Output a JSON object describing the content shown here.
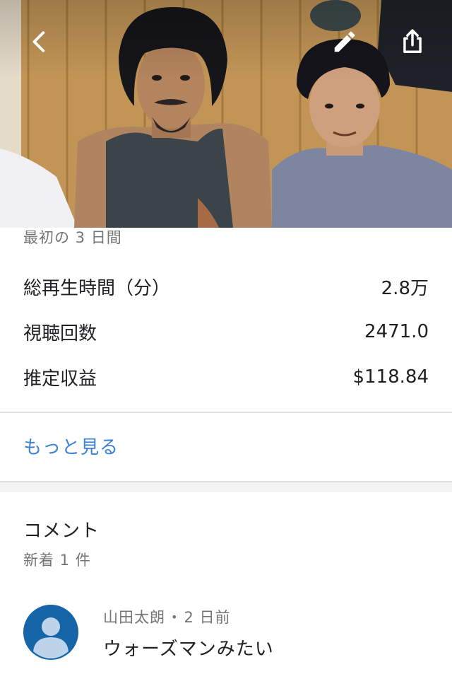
{
  "header": {
    "back_icon": "chevron-left-icon",
    "edit_icon": "pencil-icon",
    "share_icon": "share-icon"
  },
  "stats": {
    "period_label": "最初の 3 日間",
    "rows": [
      {
        "label": "総再生時間（分）",
        "value": "2.8万"
      },
      {
        "label": "視聴回数",
        "value": "2471.0"
      },
      {
        "label": "推定収益",
        "value": "$118.84"
      }
    ],
    "more_label": "もっと見る"
  },
  "comments": {
    "title": "コメント",
    "subtitle": "新着 1 件",
    "items": [
      {
        "author": "山田太朗",
        "separator": "•",
        "time": "2 日前",
        "text": "ウォーズマンみたい",
        "avatar_icon": "default-user-avatar-icon"
      }
    ]
  },
  "colors": {
    "link": "#3b82d6",
    "avatar_bg": "#1565a8",
    "divider": "#e0e0e0",
    "secondary_text": "#757575"
  }
}
